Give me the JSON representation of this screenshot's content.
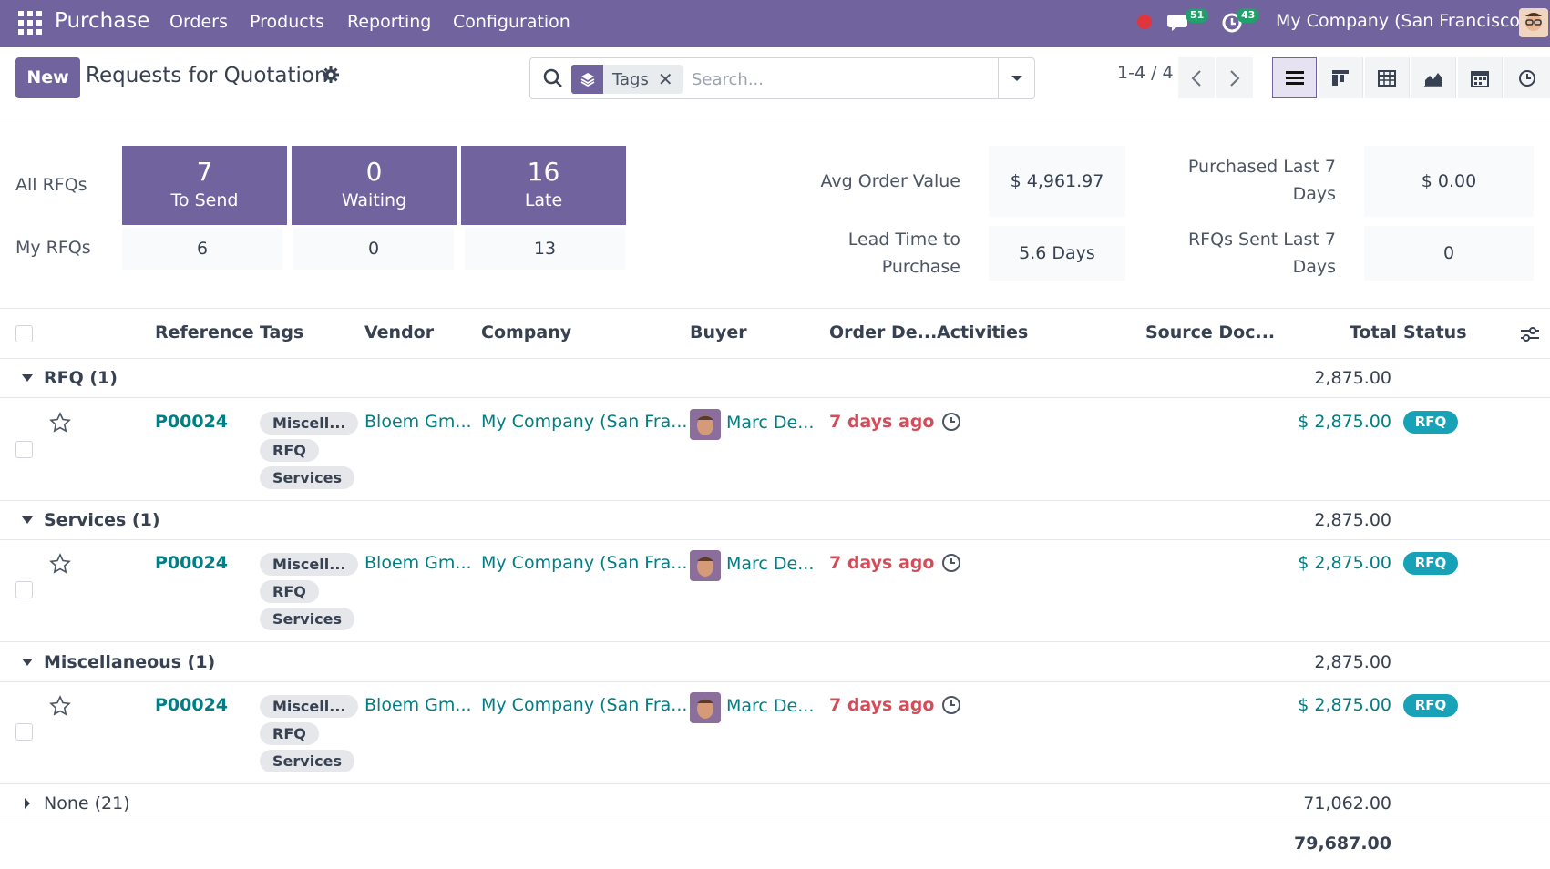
{
  "navbar": {
    "app_name": "Purchase",
    "menu": [
      "Orders",
      "Products",
      "Reporting",
      "Configuration"
    ],
    "messages_count": "51",
    "activities_count": "43",
    "company": "My Company (San Francisco)"
  },
  "control": {
    "new_label": "New",
    "title": "Requests for Quotation",
    "facet": "Tags",
    "search_placeholder": "Search...",
    "pager": "1-4 / 4"
  },
  "dashboard": {
    "all_rfqs_label": "All RFQs",
    "my_rfqs_label": "My RFQs",
    "tiles": [
      {
        "num": "7",
        "label": "To Send",
        "mine": "6"
      },
      {
        "num": "0",
        "label": "Waiting",
        "mine": "0"
      },
      {
        "num": "16",
        "label": "Late",
        "mine": "13"
      }
    ],
    "kpis": {
      "avg_order_label": "Avg Order Value",
      "avg_order_value": "$ 4,961.97",
      "lead_time_label_1": "Lead Time to",
      "lead_time_label_2": "Purchase",
      "lead_time_value": "5.6 Days",
      "purchased_label_1": "Purchased Last 7",
      "purchased_label_2": "Days",
      "purchased_value": "$ 0.00",
      "rfqs_sent_label_1": "RFQs Sent Last 7",
      "rfqs_sent_label_2": "Days",
      "rfqs_sent_value": "0"
    }
  },
  "table": {
    "columns": [
      "Reference",
      "Tags",
      "Vendor",
      "Company",
      "Buyer",
      "Order De...",
      "Activities",
      "Source Doc...",
      "Total",
      "Status"
    ],
    "groups": [
      {
        "name": "RFQ (1)",
        "total": "2,875.00"
      },
      {
        "name": "Services (1)",
        "total": "2,875.00"
      },
      {
        "name": "Miscellaneous (1)",
        "total": "2,875.00"
      },
      {
        "name": "None (21)",
        "total": "71,062.00"
      }
    ],
    "row": {
      "reference": "P00024",
      "tags": [
        "Miscell...",
        "RFQ",
        "Services"
      ],
      "vendor": "Bloem Gm...",
      "company": "My Company (San Fra...",
      "buyer": "Marc De...",
      "order_deadline": "7 days ago",
      "total": "$ 2,875.00",
      "status": "RFQ"
    },
    "grand_total": "79,687.00"
  },
  "colors": {
    "brand": "#71639e",
    "link": "#017e84",
    "late": "#d44c59",
    "status_rfq": "#17a2b8",
    "badge": "#22a06b"
  }
}
